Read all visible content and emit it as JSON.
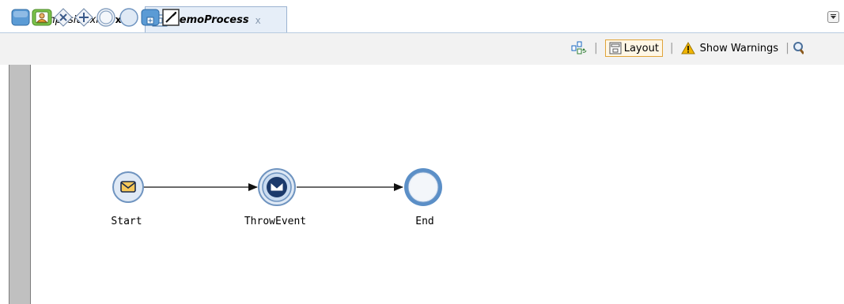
{
  "tabs": [
    {
      "label": "composite.xml",
      "close": "x",
      "icon": "composite-icon"
    },
    {
      "label": "DemoProcess",
      "close": "x",
      "icon": "process-icon",
      "active": true
    }
  ],
  "toolbar": {
    "palette": [
      "activity-icon",
      "user-task-icon",
      "exclusive-gateway-icon",
      "parallel-gateway-icon",
      "intermediate-event-icon",
      "start-event-icon",
      "subprocess-icon",
      "annotation-icon"
    ],
    "layout_label": "Layout",
    "warnings_label": "Show Warnings",
    "separator": "|"
  },
  "diagram": {
    "nodes": [
      {
        "id": "start",
        "label": "Start",
        "icon": "message-icon"
      },
      {
        "id": "throw",
        "label": "ThrowEvent",
        "icon": "throw-message-icon"
      },
      {
        "id": "end",
        "label": "End",
        "icon": "end-event-icon"
      }
    ],
    "flows": [
      [
        "start",
        "throw"
      ],
      [
        "throw",
        "end"
      ]
    ]
  },
  "colors": {
    "accent": "#5b8fc7",
    "event_fill": "#dfe9f5",
    "lane": "#c0c0c0",
    "warning": "#f2b600"
  }
}
